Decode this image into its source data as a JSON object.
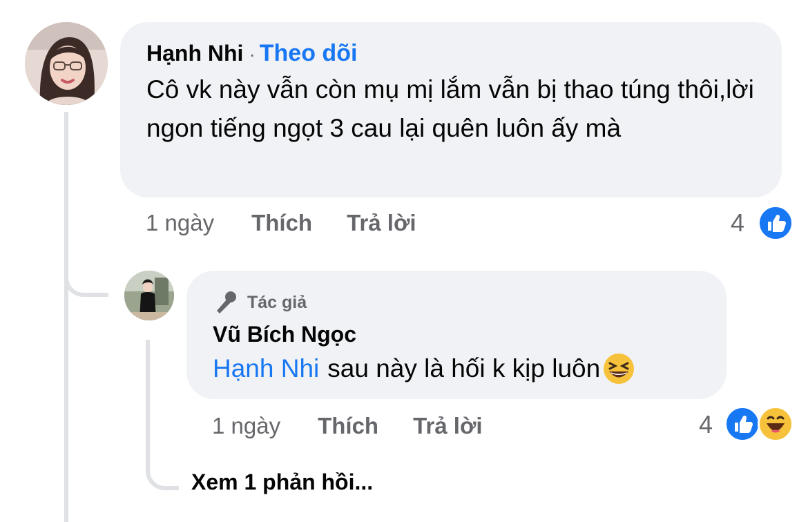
{
  "comment": {
    "author": "Hạnh Nhi",
    "separator": "·",
    "follow_label": "Theo dõi",
    "text": "Cô vk này vẫn còn mụ mị lắm vẫn bị thao túng thôi,lời ngon tiếng ngọt 3 cau lại quên luôn ấy mà",
    "time": "1 ngày",
    "like_label": "Thích",
    "reply_label": "Trả lời",
    "reaction_count": "4",
    "reactions": [
      "like-icon"
    ]
  },
  "reply": {
    "badge_label": "Tác giả",
    "badge_icon": "microphone-icon",
    "author": "Vũ Bích Ngọc",
    "mention": "Hạnh Nhi",
    "text": "sau này là hối k kịp luôn",
    "emoji": "grinning-squinting-face",
    "time": "1 ngày",
    "like_label": "Thích",
    "reply_label": "Trả lời",
    "reaction_count": "4",
    "reactions": [
      "like-icon",
      "haha-icon"
    ]
  },
  "view_more": "Xem 1 phản hồi...",
  "colors": {
    "link": "#1877f2",
    "bubble": "#f0f2f5",
    "muted": "#65676b",
    "text": "#050505"
  }
}
